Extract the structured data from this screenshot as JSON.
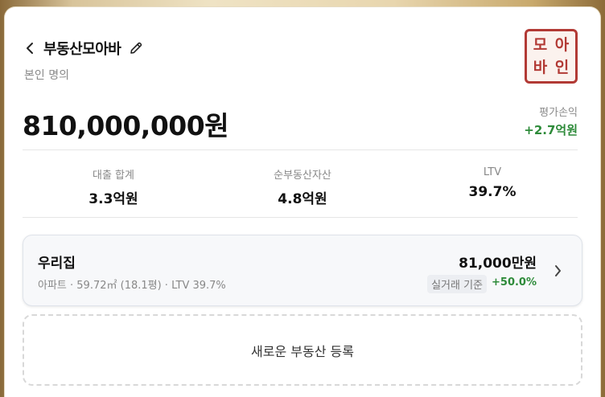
{
  "header": {
    "back_icon": "chevron-left-icon",
    "title": "부동산모아바",
    "edit_icon": "pencil-icon",
    "owner_label": "본인 명의"
  },
  "stamp": {
    "chars": [
      "모",
      "아",
      "바",
      "인"
    ],
    "color": "#b23a35"
  },
  "summary": {
    "total_amount": "810,000,000원",
    "pnl_label": "평가손익",
    "pnl_value": "+2.7억원",
    "pnl_color": "#2e8b3a"
  },
  "stats": [
    {
      "label": "대출 합계",
      "value": "3.3억원"
    },
    {
      "label": "순부동산자산",
      "value": "4.8억원"
    },
    {
      "label": "LTV",
      "value": "39.7%"
    }
  ],
  "properties": [
    {
      "name": "우리집",
      "meta": "아파트 · 59.72㎡ (18.1평) · LTV 39.7%",
      "price": "81,000만원",
      "basis": "실거래 기준",
      "gain": "+50.0%",
      "chevron_icon": "chevron-right-icon"
    }
  ],
  "add_button_label": "새로운 부동산 등록",
  "colors": {
    "frame_gold": "#d8c49a",
    "positive": "#2e8b3a"
  }
}
